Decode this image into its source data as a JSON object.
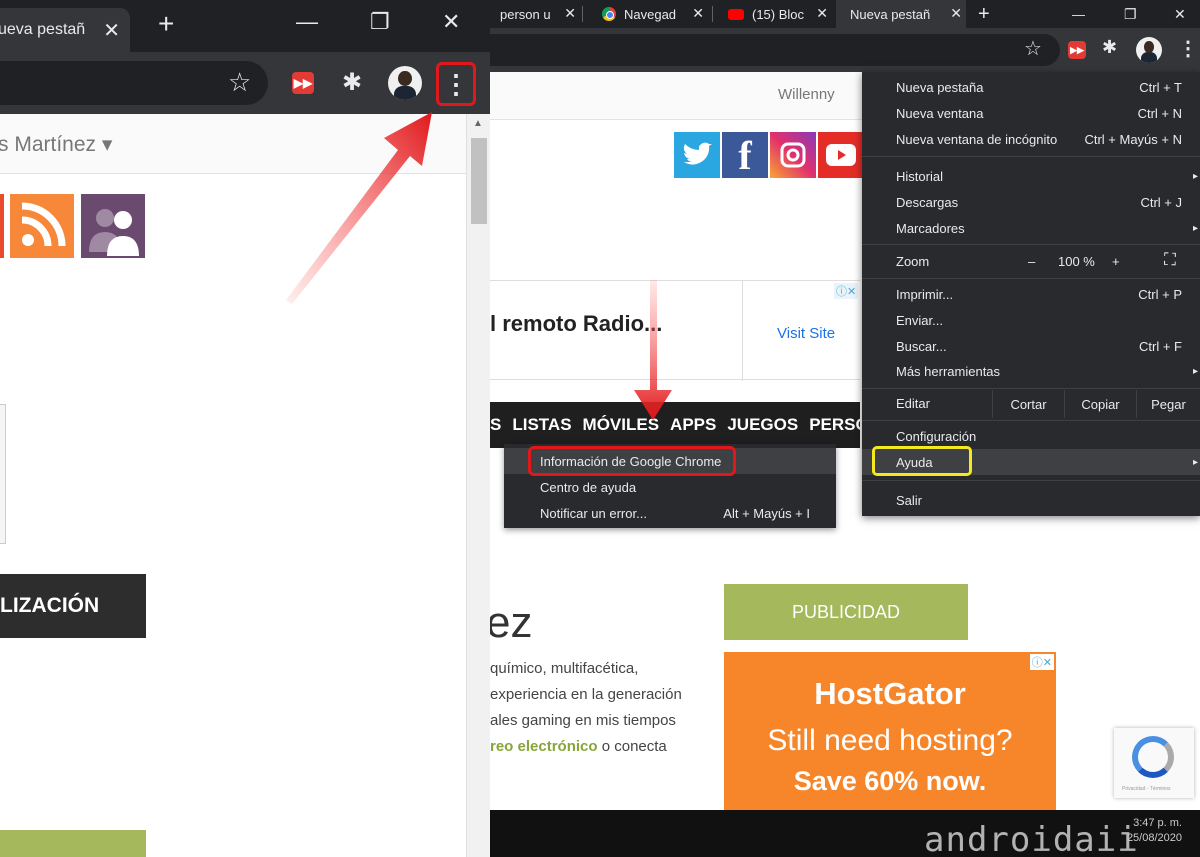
{
  "left": {
    "tab": {
      "label": "ueva pestañ",
      "close": "✕"
    },
    "new_tab": "+",
    "window_controls": {
      "minimize": "—",
      "restore": "❐",
      "close": "✕"
    },
    "username": "s Martínez ▾",
    "dark_button": "LIZACIÓN"
  },
  "right": {
    "tabs": [
      {
        "label": "person u"
      },
      {
        "label": "Navegad"
      },
      {
        "label": "(15) Bloc"
      },
      {
        "label": "Nueva pestañ"
      }
    ],
    "tab_close": "✕",
    "new_tab": "+",
    "window_controls": {
      "minimize": "—",
      "restore": "❐",
      "close": "✕"
    },
    "username": "Willenny",
    "ad": {
      "title": "l remoto Radio...",
      "visit": "Visit Site",
      "adchoice": "ⓘ✕"
    },
    "nav": [
      "S",
      "LISTAS",
      "MÓVILES",
      "APPS",
      "JUEGOS",
      "PERSONA"
    ],
    "name_fragment": "ez",
    "bio": {
      "line1": "químico, multifacética,",
      "line2": "experiencia en la generación",
      "line3": "ales gaming en mis tiempos",
      "link": "reo electrónico",
      "line4_rest": " o conecta"
    },
    "publicidad": "PUBLICIDAD",
    "hostgator": {
      "title": "HostGator",
      "sub": "Still need hosting?",
      "save": "Save 60% now.",
      "adchoice": "ⓘ✕"
    },
    "recaptcha_text": "Privacidad - Términos",
    "taskbar": {
      "time": "3:47 p. m.",
      "date": "25/08/2020"
    },
    "watermark": "androidaii"
  },
  "menu": {
    "items": [
      {
        "label": "Nueva pestaña",
        "shortcut": "Ctrl + T"
      },
      {
        "label": "Nueva ventana",
        "shortcut": "Ctrl + N"
      },
      {
        "label": "Nueva ventana de incógnito",
        "shortcut": "Ctrl + Mayús + N"
      },
      {
        "label": "Historial",
        "shortcut": ""
      },
      {
        "label": "Descargas",
        "shortcut": "Ctrl + J"
      },
      {
        "label": "Marcadores",
        "shortcut": ""
      },
      {
        "label": "Imprimir...",
        "shortcut": "Ctrl + P"
      },
      {
        "label": "Enviar...",
        "shortcut": ""
      },
      {
        "label": "Buscar...",
        "shortcut": "Ctrl + F"
      },
      {
        "label": "Más herramientas",
        "shortcut": ""
      },
      {
        "label": "Configuración",
        "shortcut": ""
      },
      {
        "label": "Ayuda",
        "shortcut": ""
      },
      {
        "label": "Salir",
        "shortcut": ""
      }
    ],
    "zoom": {
      "label": "Zoom",
      "minus": "–",
      "value": "100 %",
      "plus": "+",
      "fullscreen": "⛶"
    },
    "edit": {
      "label": "Editar",
      "cut": "Cortar",
      "copy": "Copiar",
      "paste": "Pegar"
    },
    "submenu_arrow": "▸"
  },
  "help_submenu": {
    "items": [
      {
        "label": "Información de Google Chrome",
        "shortcut": ""
      },
      {
        "label": "Centro de ayuda",
        "shortcut": ""
      },
      {
        "label": "Notificar un error...",
        "shortcut": "Alt + Mayús + I"
      }
    ]
  },
  "colors": {
    "chrome_dark": "#202124",
    "toolbar": "#35363a",
    "menu_bg": "#292a2d",
    "highlight_red": "#e0181b",
    "highlight_yellow": "#f5e81c",
    "accent_green": "#a5b85b",
    "hostgator_orange": "#f7862b"
  },
  "icons": {
    "star": "☆",
    "puzzle": "✱",
    "kebab": "⋮",
    "ext": "▶▶"
  }
}
